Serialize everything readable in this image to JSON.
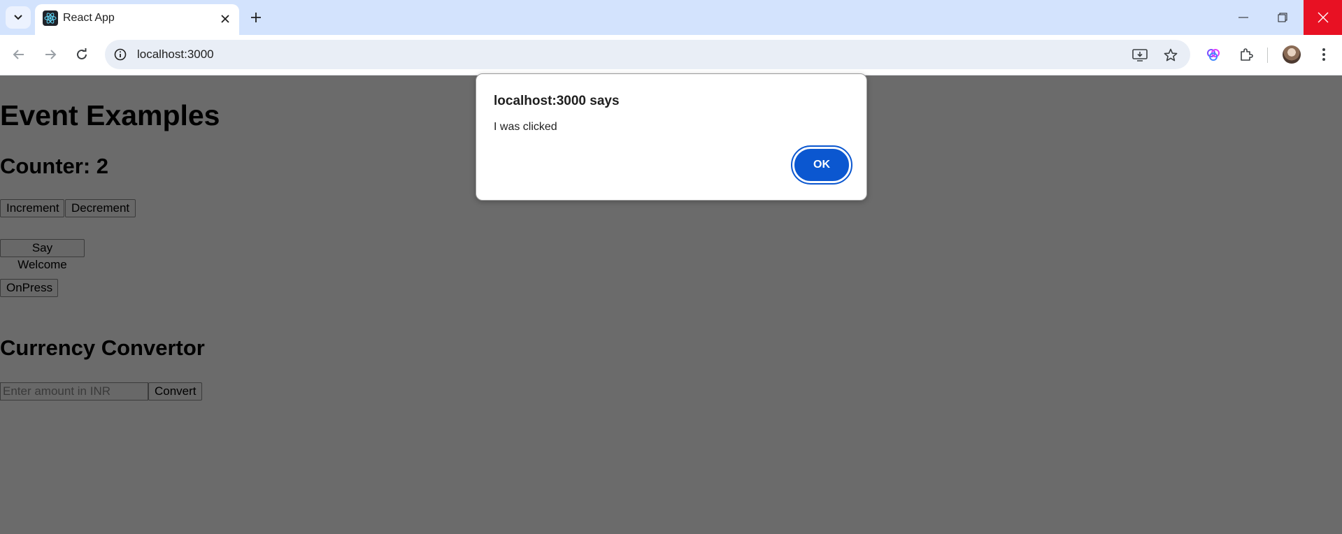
{
  "browser": {
    "tab_title": "React App",
    "url": "localhost:3000"
  },
  "page": {
    "heading": "Event Examples",
    "counter_label": "Counter: 2",
    "buttons": {
      "increment": "Increment",
      "decrement": "Decrement",
      "say_welcome": "Say Welcome",
      "on_press": "OnPress"
    },
    "currency": {
      "heading": "Currency Convertor",
      "input_placeholder": "Enter amount in INR",
      "input_value": "",
      "convert_label": "Convert"
    }
  },
  "dialog": {
    "title": "localhost:3000 says",
    "message": "I was clicked",
    "ok_label": "OK"
  },
  "colors": {
    "tabbar_bg": "#d3e3fd",
    "close_red": "#e81123",
    "ok_blue": "#0b57d0",
    "page_dim": "#6b6b6b"
  },
  "icons": [
    "tab-search-icon",
    "react-logo-icon",
    "close-icon",
    "plus-icon",
    "minimize-icon",
    "restore-icon",
    "back-arrow-icon",
    "forward-arrow-icon",
    "reload-icon",
    "site-info-icon",
    "install-app-icon",
    "star-icon",
    "gemini-icon",
    "extensions-icon",
    "kebab-menu-icon"
  ]
}
